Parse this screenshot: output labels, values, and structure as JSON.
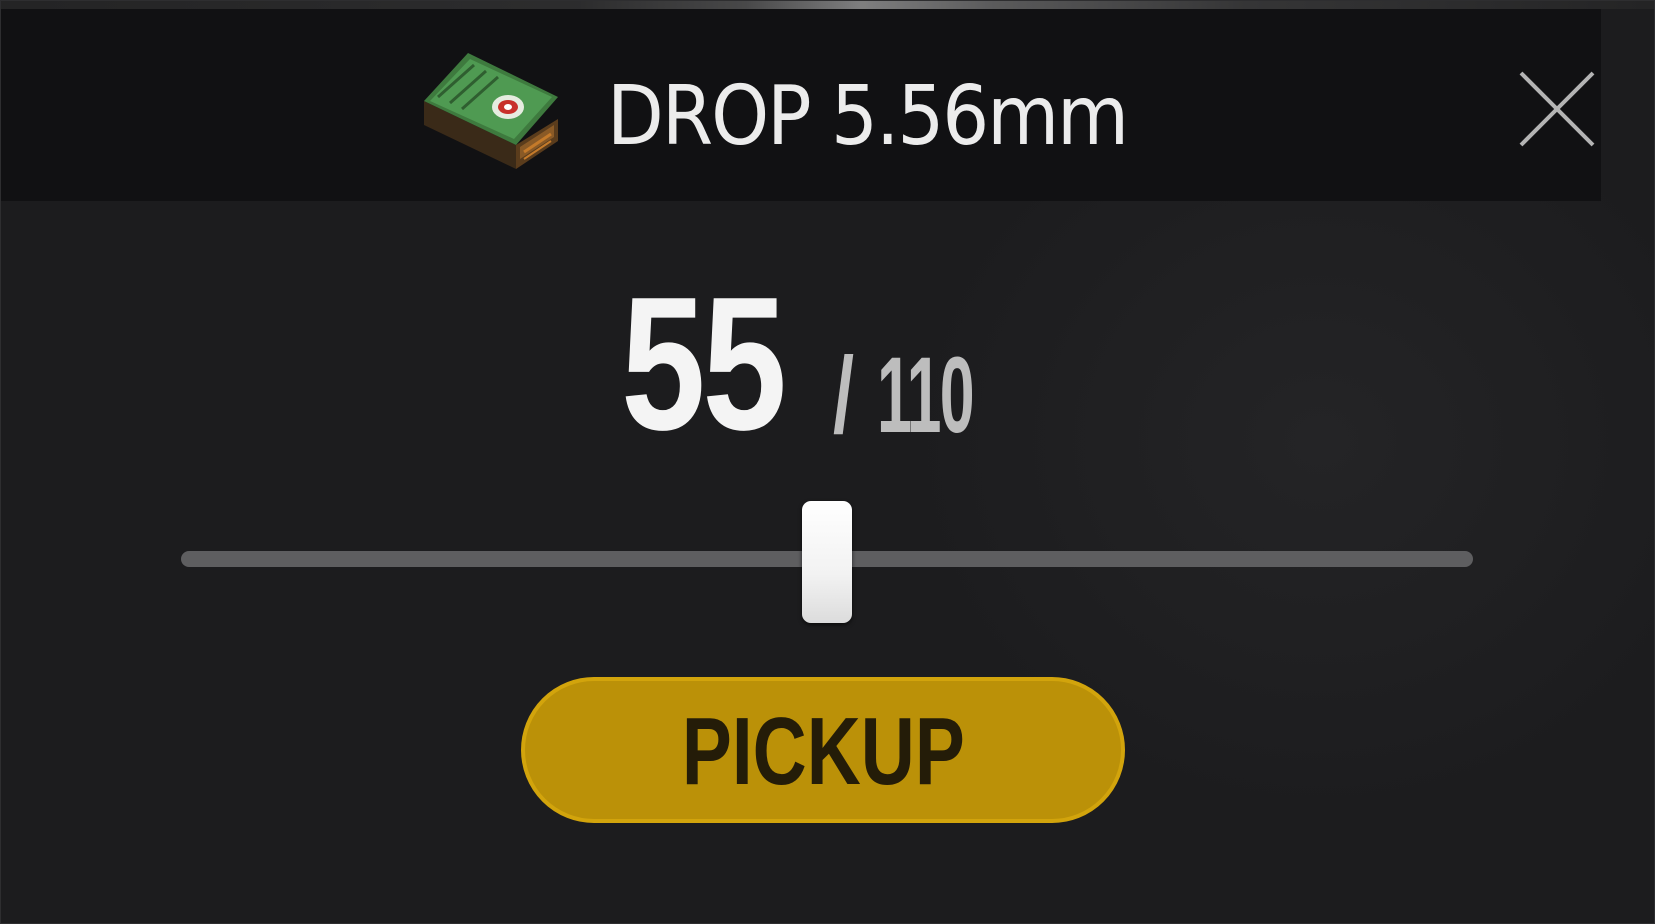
{
  "dialog": {
    "title": "DROP 5.56mm",
    "item_icon": "ammo-box-icon",
    "close_icon": "close-icon"
  },
  "quantity": {
    "current": "55",
    "separator": "/",
    "max": "110",
    "slider_value": 55,
    "slider_min": 0,
    "slider_max": 110
  },
  "actions": {
    "confirm_label": "PICKUP"
  },
  "colors": {
    "accent_button": "#bb9108",
    "panel_background": "#1c1c1e",
    "header_background": "#111113",
    "slider_track": "#5e5e60",
    "slider_thumb": "#f2f2f2"
  }
}
